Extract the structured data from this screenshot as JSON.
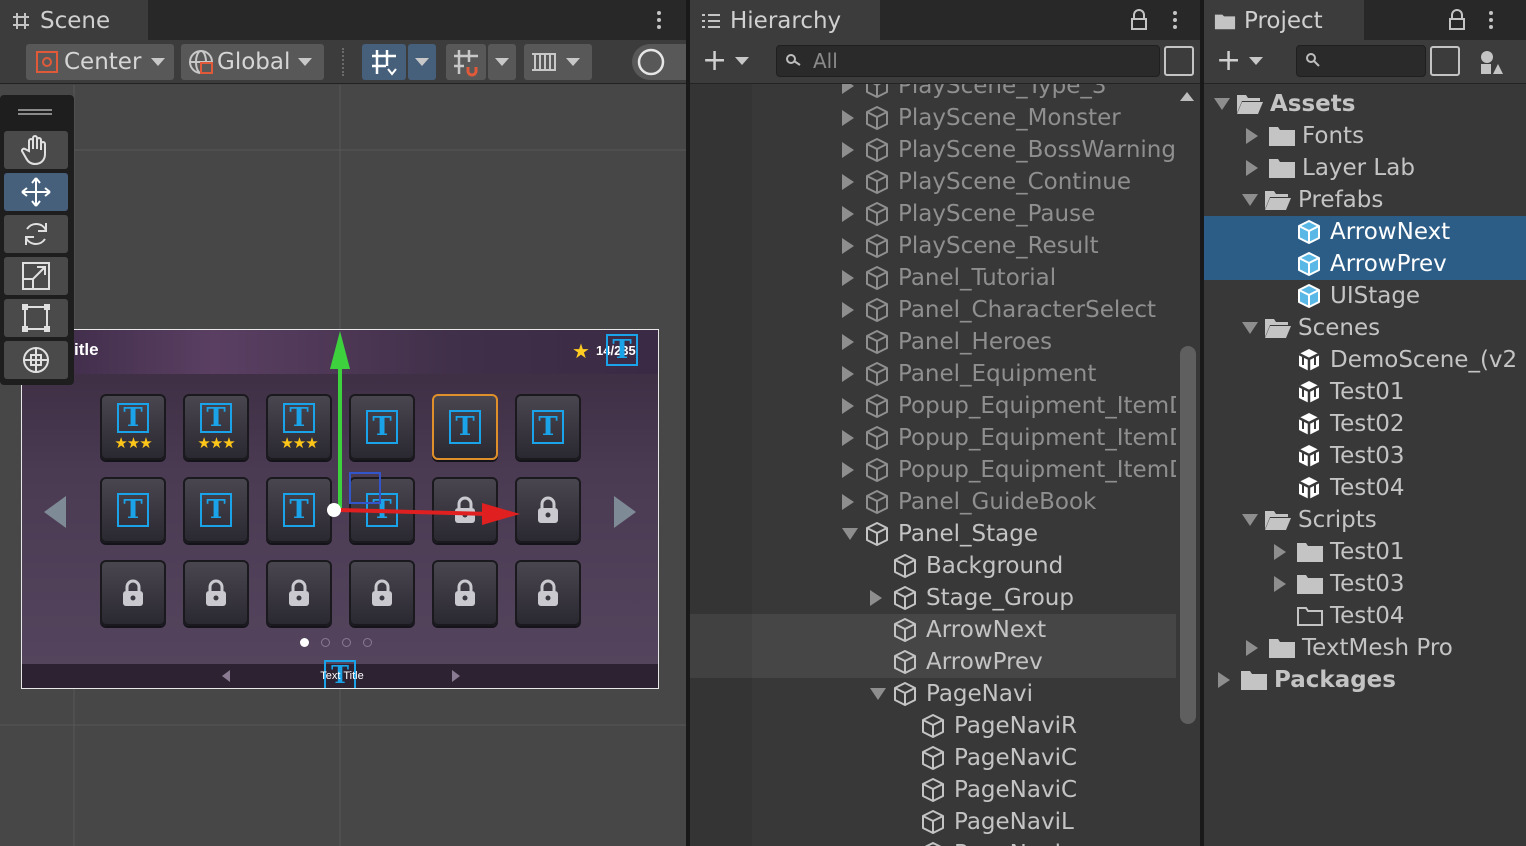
{
  "scene": {
    "tab_label": "Scene",
    "pivot_label": "Center",
    "space_label": "Global",
    "game_ui": {
      "title_text": "itle",
      "coin_text": "14/235",
      "footer_text": "Text Title",
      "stars_per_tile": "★★★",
      "tiles": [
        {
          "type": "text",
          "stars": true,
          "glow": false
        },
        {
          "type": "text",
          "stars": true,
          "glow": false
        },
        {
          "type": "text",
          "stars": true,
          "glow": false
        },
        {
          "type": "text",
          "stars": false,
          "glow": false
        },
        {
          "type": "text",
          "stars": false,
          "glow": true
        },
        {
          "type": "text",
          "stars": false,
          "glow": false
        },
        {
          "type": "text",
          "stars": false,
          "glow": false
        },
        {
          "type": "text",
          "stars": false,
          "glow": false
        },
        {
          "type": "text",
          "stars": false,
          "glow": false
        },
        {
          "type": "text",
          "stars": false,
          "glow": false
        },
        {
          "type": "lock",
          "stars": false,
          "glow": false
        },
        {
          "type": "lock",
          "stars": false,
          "glow": false
        },
        {
          "type": "lock",
          "stars": false,
          "glow": false
        },
        {
          "type": "lock",
          "stars": false,
          "glow": false
        },
        {
          "type": "lock",
          "stars": false,
          "glow": false
        },
        {
          "type": "lock",
          "stars": false,
          "glow": false
        },
        {
          "type": "lock",
          "stars": false,
          "glow": false
        },
        {
          "type": "lock",
          "stars": false,
          "glow": false
        }
      ],
      "page_dots": 4,
      "active_dot": 1
    },
    "tools": [
      "hand-tool",
      "move-tool",
      "rotate-tool",
      "scale-tool",
      "rect-tool",
      "transform-tool"
    ],
    "active_tool": 1
  },
  "hierarchy": {
    "tab_label": "Hierarchy",
    "search_placeholder": "All",
    "items": [
      {
        "label": "PlayScene_Type_3",
        "depth": 0,
        "expand": "collapsed",
        "dim": true,
        "state": ""
      },
      {
        "label": "PlayScene_Monster",
        "depth": 0,
        "expand": "collapsed",
        "dim": true,
        "state": ""
      },
      {
        "label": "PlayScene_BossWarning",
        "depth": 0,
        "expand": "collapsed",
        "dim": true,
        "state": ""
      },
      {
        "label": "PlayScene_Continue",
        "depth": 0,
        "expand": "collapsed",
        "dim": true,
        "state": ""
      },
      {
        "label": "PlayScene_Pause",
        "depth": 0,
        "expand": "collapsed",
        "dim": true,
        "state": ""
      },
      {
        "label": "PlayScene_Result",
        "depth": 0,
        "expand": "collapsed",
        "dim": true,
        "state": ""
      },
      {
        "label": "Panel_Tutorial",
        "depth": 0,
        "expand": "collapsed",
        "dim": true,
        "state": ""
      },
      {
        "label": "Panel_CharacterSelect",
        "depth": 0,
        "expand": "collapsed",
        "dim": true,
        "state": ""
      },
      {
        "label": "Panel_Heroes",
        "depth": 0,
        "expand": "collapsed",
        "dim": true,
        "state": ""
      },
      {
        "label": "Panel_Equipment",
        "depth": 0,
        "expand": "collapsed",
        "dim": true,
        "state": ""
      },
      {
        "label": "Popup_Equipment_ItemD",
        "depth": 0,
        "expand": "collapsed",
        "dim": true,
        "state": ""
      },
      {
        "label": "Popup_Equipment_ItemD",
        "depth": 0,
        "expand": "collapsed",
        "dim": true,
        "state": ""
      },
      {
        "label": "Popup_Equipment_ItemD",
        "depth": 0,
        "expand": "collapsed",
        "dim": true,
        "state": ""
      },
      {
        "label": "Panel_GuideBook",
        "depth": 0,
        "expand": "collapsed",
        "dim": true,
        "state": ""
      },
      {
        "label": "Panel_Stage",
        "depth": 0,
        "expand": "expanded",
        "dim": false,
        "state": ""
      },
      {
        "label": "Background",
        "depth": 1,
        "expand": "none",
        "dim": false,
        "state": ""
      },
      {
        "label": "Stage_Group",
        "depth": 1,
        "expand": "collapsed",
        "dim": false,
        "state": ""
      },
      {
        "label": "ArrowNext",
        "depth": 1,
        "expand": "none",
        "dim": false,
        "state": "highlight"
      },
      {
        "label": "ArrowPrev",
        "depth": 1,
        "expand": "none",
        "dim": false,
        "state": "highlight"
      },
      {
        "label": "PageNavi",
        "depth": 1,
        "expand": "expanded",
        "dim": false,
        "state": ""
      },
      {
        "label": "PageNaviR",
        "depth": 2,
        "expand": "none",
        "dim": false,
        "state": ""
      },
      {
        "label": "PageNaviC",
        "depth": 2,
        "expand": "none",
        "dim": false,
        "state": ""
      },
      {
        "label": "PageNaviC",
        "depth": 2,
        "expand": "none",
        "dim": false,
        "state": ""
      },
      {
        "label": "PageNaviL",
        "depth": 2,
        "expand": "none",
        "dim": false,
        "state": ""
      },
      {
        "label": "PageNavi",
        "depth": 2,
        "expand": "none",
        "dim": false,
        "state": ""
      }
    ]
  },
  "project": {
    "tab_label": "Project",
    "items": [
      {
        "label": "Assets",
        "depth": 0,
        "expand": "expanded",
        "icon": "folder-open",
        "bold": true,
        "selected": false
      },
      {
        "label": "Fonts",
        "depth": 1,
        "expand": "collapsed",
        "icon": "folder",
        "bold": false,
        "selected": false
      },
      {
        "label": "Layer Lab",
        "depth": 1,
        "expand": "collapsed",
        "icon": "folder",
        "bold": false,
        "selected": false
      },
      {
        "label": "Prefabs",
        "depth": 1,
        "expand": "expanded",
        "icon": "folder-open",
        "bold": false,
        "selected": false
      },
      {
        "label": "ArrowNext",
        "depth": 2,
        "expand": "none",
        "icon": "prefab",
        "bold": false,
        "selected": true
      },
      {
        "label": "ArrowPrev",
        "depth": 2,
        "expand": "none",
        "icon": "prefab",
        "bold": false,
        "selected": true
      },
      {
        "label": "UIStage",
        "depth": 2,
        "expand": "none",
        "icon": "prefab",
        "bold": false,
        "selected": false
      },
      {
        "label": "Scenes",
        "depth": 1,
        "expand": "expanded",
        "icon": "folder-open",
        "bold": false,
        "selected": false
      },
      {
        "label": "DemoScene_(v2",
        "depth": 2,
        "expand": "none",
        "icon": "scene",
        "bold": false,
        "selected": false
      },
      {
        "label": "Test01",
        "depth": 2,
        "expand": "none",
        "icon": "scene",
        "bold": false,
        "selected": false
      },
      {
        "label": "Test02",
        "depth": 2,
        "expand": "none",
        "icon": "scene",
        "bold": false,
        "selected": false
      },
      {
        "label": "Test03",
        "depth": 2,
        "expand": "none",
        "icon": "scene",
        "bold": false,
        "selected": false
      },
      {
        "label": "Test04",
        "depth": 2,
        "expand": "none",
        "icon": "scene",
        "bold": false,
        "selected": false
      },
      {
        "label": "Scripts",
        "depth": 1,
        "expand": "expanded",
        "icon": "folder-open",
        "bold": false,
        "selected": false
      },
      {
        "label": "Test01",
        "depth": 2,
        "expand": "collapsed",
        "icon": "folder",
        "bold": false,
        "selected": false
      },
      {
        "label": "Test03",
        "depth": 2,
        "expand": "collapsed",
        "icon": "folder",
        "bold": false,
        "selected": false
      },
      {
        "label": "Test04",
        "depth": 2,
        "expand": "none",
        "icon": "folder-empty",
        "bold": false,
        "selected": false
      },
      {
        "label": "TextMesh Pro",
        "depth": 1,
        "expand": "collapsed",
        "icon": "folder",
        "bold": false,
        "selected": false
      },
      {
        "label": "Packages",
        "depth": 0,
        "expand": "collapsed",
        "icon": "folder",
        "bold": true,
        "selected": false
      }
    ]
  },
  "colors": {
    "selection": "#2c5d87",
    "accent_blue": "#1aa3e8",
    "axis_x": "#e02020",
    "axis_y": "#3ed13e"
  }
}
